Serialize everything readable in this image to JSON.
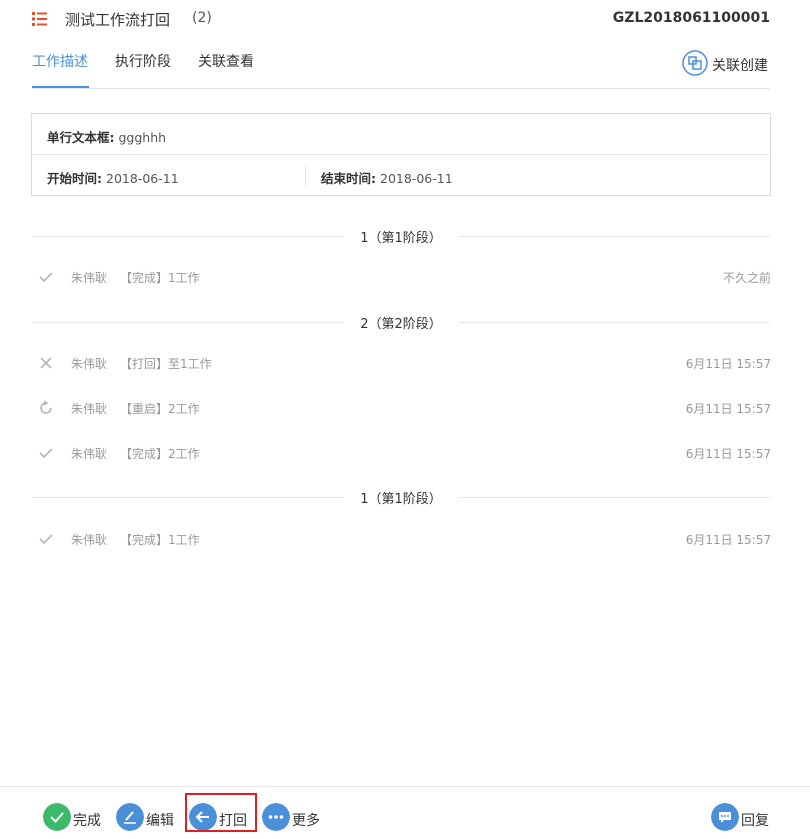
{
  "header": {
    "title": "测试工作流打回",
    "count": "(2)",
    "code": "GZL2018061100001",
    "list_icon": "list-icon"
  },
  "tabs": [
    {
      "label": "工作描述",
      "active": true
    },
    {
      "label": "执行阶段",
      "active": false
    },
    {
      "label": "关联查看",
      "active": false
    }
  ],
  "assoc": {
    "label": "关联创建",
    "icon": "link-create-icon"
  },
  "fields": {
    "single_text": {
      "label": "单行文本框:",
      "value": "ggghhh"
    },
    "start": {
      "label": "开始时间:",
      "value": "2018-06-11"
    },
    "end": {
      "label": "结束时间:",
      "value": "2018-06-11"
    }
  },
  "stages": [
    {
      "label": "1（第1阶段）"
    },
    {
      "label": "2（第2阶段）"
    },
    {
      "label": "1（第1阶段）"
    }
  ],
  "entries": [
    {
      "icon": "check-icon",
      "user": "朱伟耿",
      "action": "【完成】1工作",
      "time": "不久之前"
    },
    {
      "icon": "x-icon",
      "user": "朱伟耿",
      "action": "【打回】至1工作",
      "time": "6月11日 15:57"
    },
    {
      "icon": "restart-icon",
      "user": "朱伟耿",
      "action": "【重启】2工作",
      "time": "6月11日 15:57"
    },
    {
      "icon": "check-icon",
      "user": "朱伟耿",
      "action": "【完成】2工作",
      "time": "6月11日 15:57"
    },
    {
      "icon": "check-icon",
      "user": "朱伟耿",
      "action": "【完成】1工作",
      "time": "6月11日 15:57"
    }
  ],
  "footer": {
    "complete": "完成",
    "edit": "编辑",
    "reject": "打回",
    "more": "更多",
    "reply": "回复"
  },
  "colors": {
    "accent": "#4a90d9",
    "complete": "#3cba6a",
    "highlight": "#e02020",
    "brand_icon": "#e0522c"
  }
}
